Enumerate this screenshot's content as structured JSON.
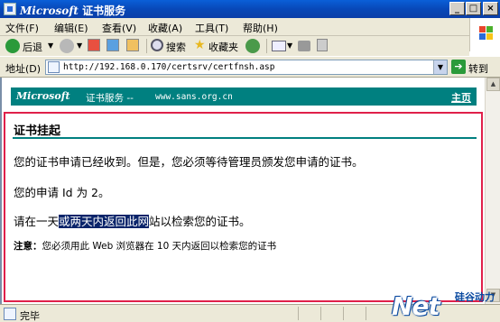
{
  "window": {
    "title_brand": "Microsoft",
    "title_rest": " 证书服务",
    "minimize": "_",
    "maximize": "□",
    "close": "×"
  },
  "menu": [
    "文件(F)",
    "编辑(E)",
    "查看(V)",
    "收藏(A)",
    "工具(T)",
    "帮助(H)"
  ],
  "toolbar": {
    "back_label": "后退",
    "search_label": "搜索",
    "favorites_label": "收藏夹"
  },
  "address": {
    "label": "地址(D)",
    "url": "http://192.168.0.170/certsrv/certfnsh.asp",
    "go_label": "转到"
  },
  "page": {
    "banner_brand": "Microsoft",
    "banner_service": "证书服务 --",
    "banner_host": "www.sans.org.cn",
    "home_link": "主页",
    "title": "证书挂起",
    "para1": "您的证书申请已经收到。但是，您必须等待管理员颁发您申请的证书。",
    "para2": "您的申请 Id 为 2。",
    "para3_before": "请在一天",
    "para3_selected": "或两天内返回此网",
    "para3_after": "站以检索您的证书。",
    "note_label": "注意：",
    "note_text": "您必须用此 Web 浏览器在 10 天内返回以检索您的证书"
  },
  "status": {
    "text": "完毕"
  },
  "watermark": {
    "brand": "Net",
    "cn_line1": "硅谷动力",
    "cn_line2": ""
  }
}
